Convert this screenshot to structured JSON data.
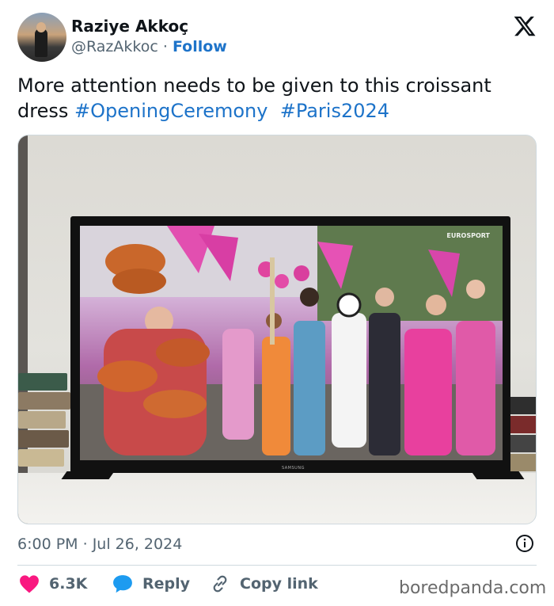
{
  "author": {
    "name": "Raziye Akkoç",
    "handle": "@RazAkkoc",
    "separator": "·",
    "follow_label": "Follow"
  },
  "tweet": {
    "text": "More attention needs to be given to this croissant dress",
    "hashtags": [
      "#OpeningCeremony",
      "#Paris2024"
    ]
  },
  "media": {
    "tv_brand": "SAMSUNG",
    "broadcaster": "EUROSPORT"
  },
  "meta": {
    "time": "6:00 PM",
    "separator": "·",
    "date": "Jul 26, 2024"
  },
  "actions": {
    "like_count": "6.3K",
    "reply_label": "Reply",
    "copy_label": "Copy link"
  },
  "watermark": "boredpanda.com",
  "colors": {
    "link": "#1d73c9",
    "like": "#f91880",
    "reply_icon": "#1d9bf0",
    "muted": "#536471"
  },
  "icons": {
    "logo": "x-logo-icon",
    "info": "info-icon",
    "like": "heart-icon",
    "reply": "speech-bubble-icon",
    "copy": "link-icon"
  }
}
